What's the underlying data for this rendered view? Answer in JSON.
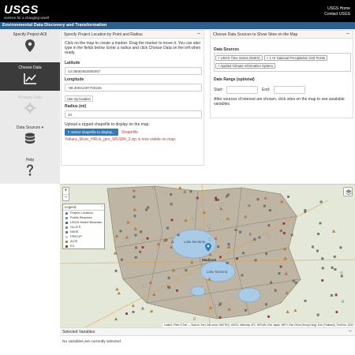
{
  "header": {
    "logo": "USGS",
    "tagline": "science for a changing world",
    "links": [
      "USGS Home",
      "Contact USGS"
    ]
  },
  "app_title": "Environmental Data Discovery and Transformation",
  "nav": {
    "items": [
      {
        "label": "Specify Project AOI",
        "icon": "map-pin-icon",
        "state": "normal"
      },
      {
        "label": "Choose Data",
        "icon": "line-chart-icon",
        "state": "active"
      },
      {
        "label": "Process Data",
        "icon": "gear-icon",
        "state": "disabled"
      },
      {
        "label": "Data Sources",
        "icon": "database-icon",
        "state": "normal"
      },
      {
        "label": "Help",
        "icon": "question-icon",
        "state": "normal"
      }
    ]
  },
  "location_panel": {
    "title": "Specify Project Location by Point and Radius",
    "instructions": "Click on the map to create a marker. Drag the marker to move it. You can also type in the fields below. Enter a radius and click Choose Data on the left when ready.",
    "latitude_label": "Latitude",
    "latitude_value": "43.08682662805057",
    "longitude_label": "Longitude",
    "longitude_value": "-89.30031497700165",
    "use_location_label": "Use my location",
    "radius_label": "Radius (mi)",
    "radius_value": "10",
    "upload_text": "Upload a zipped shapefile to display on the map.",
    "shapefile_button": "Select shapefile to display...",
    "shapefile_word": "Shapefile",
    "shapefile_status": "Yahara_River_HRUs_geo_WGS84_2.zip is now visible on map."
  },
  "sources_panel": {
    "title": "Choose Data Sources to Show Sites on the Map",
    "data_sources_label": "Data Sources",
    "chips": [
      "× USGS Time Series (NWIS)",
      "× 1 Hr National Precipitation Grid Points",
      "× Applied Climate Information System"
    ],
    "date_range_label": "Date Range (optional)",
    "start_label": "Start:",
    "end_label": "End:",
    "note": "After sources of interest are chosen, click sites on the map to see available variables."
  },
  "map": {
    "zoom_in": "+",
    "zoom_out": "−",
    "legend_title": "Legend",
    "legend_items": [
      {
        "label": "Project Location",
        "color": "#2f7fc0"
      },
      {
        "label": "Public Beaches",
        "color": "#5a9bd5"
      },
      {
        "label": "USGS Model Beaches",
        "color": "#3a6fb0"
      },
      {
        "label": "GLCFS",
        "color": "#4aa0b0"
      },
      {
        "label": "NWIS",
        "color": "#777777"
      },
      {
        "label": "PRECIP",
        "color": "#cccccc"
      },
      {
        "label": "ACIS",
        "color": "#e07a20"
      },
      {
        "label": "EC",
        "color": "#b03030"
      }
    ],
    "place_labels": [
      "Lake Mendota",
      "Madison",
      "Lake Monona"
    ],
    "attribution": "Leaflet | Tiles © Esri — Source: Esri, DeLorme, NAVTEQ, USGS, Intermap, iPC, NRCAN, Esri Japan, METI, Esri China (Hong Kong), Esri (Thailand), TomTom, 2012"
  },
  "selected_variables": {
    "title": "Selected Variables",
    "empty_text": "No variables are currently selected"
  },
  "colors": {
    "header_bg": "#000000",
    "app_bar": "#2f5f8f",
    "nav_active": "#3b3b3b",
    "button_blue": "#337ab7",
    "status_red": "#a94442"
  }
}
